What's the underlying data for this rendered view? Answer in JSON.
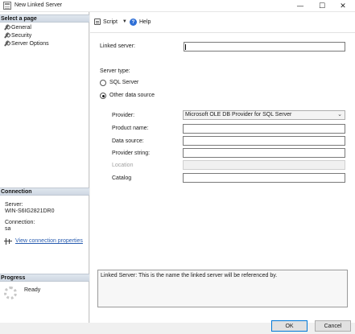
{
  "window": {
    "title": "New Linked Server",
    "minimize_glyph": "—",
    "maximize_glyph": "☐",
    "close_glyph": "✕"
  },
  "left_pane": {
    "select_page_header": "Select a page",
    "pages": [
      {
        "label": "General",
        "icon": "wrench-icon"
      },
      {
        "label": "Security",
        "icon": "wrench-icon"
      },
      {
        "label": "Server Options",
        "icon": "wrench-icon"
      }
    ],
    "connection_header": "Connection",
    "server_label": "Server:",
    "server_value": "WIN-S6IG2821DR0",
    "connection_label": "Connection:",
    "connection_value": "sa",
    "view_connection_link": "View connection properties",
    "progress_header": "Progress",
    "progress_status": "Ready"
  },
  "toolbar": {
    "script_label": "Script",
    "dropdown_glyph": "▼",
    "help_label": "Help",
    "help_glyph": "?"
  },
  "form": {
    "linked_server_label": "Linked server:",
    "linked_server_value": "",
    "server_type_label": "Server type:",
    "sql_server_option": "SQL Server",
    "other_source_option": "Other data source",
    "selected_server_type": "Other data source",
    "provider_label": "Provider:",
    "provider_value": "Microsoft OLE DB Provider for SQL Server",
    "provider_chevron": "⌄",
    "product_name_label": "Product name:",
    "product_name_value": "",
    "data_source_label": "Data source:",
    "data_source_value": "",
    "provider_string_label": "Provider string:",
    "provider_string_value": "",
    "location_label": "Location",
    "location_value": "",
    "catalog_label": "Catalog",
    "catalog_value": ""
  },
  "description": "Linked Server: This is the name the linked server will be referenced by.",
  "buttons": {
    "ok": "OK",
    "cancel": "Cancel"
  },
  "colors": {
    "link": "#2a5db0",
    "help_icon": "#2f6fd6",
    "ok_border": "#0078d7"
  }
}
